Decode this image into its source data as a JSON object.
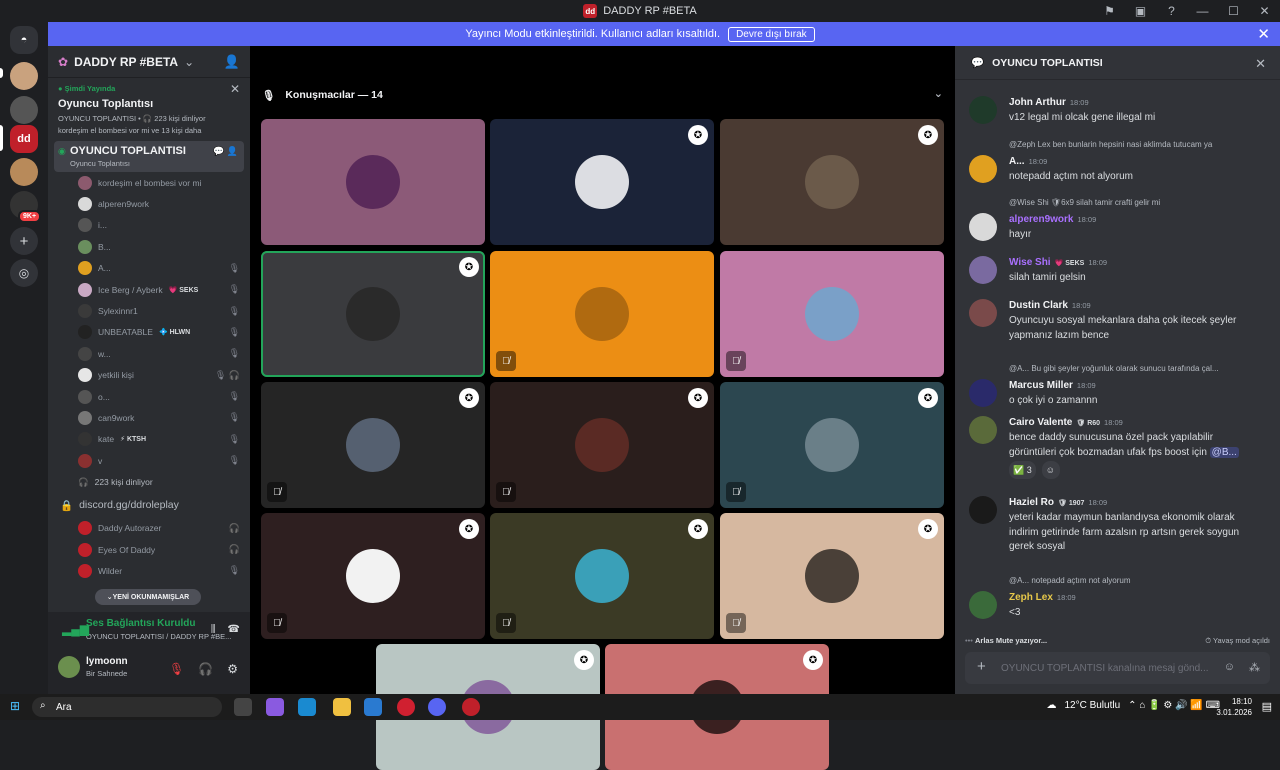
{
  "window": {
    "title": "DADDY RP #BETA",
    "logo": "dd"
  },
  "banner": {
    "text": "Yayıncı Modu etkinleştirildi. Kullanıcı adları kısaltıldı.",
    "button": "Devre dışı bırak"
  },
  "rail": {
    "badge_9k": "9K+"
  },
  "server": {
    "name": "DADDY RP #BETA"
  },
  "live": {
    "status": "Şimdi Yayında",
    "title": "Oyuncu Toplantısı",
    "meta": "OYUNCU TOPLANTISI • 🎧 223 kişi dinliyor",
    "activity": "kordeşim el bombesi vor mi ve 13 kişi daha"
  },
  "active_channel": {
    "name": "OYUNCU TOPLANTISI",
    "subtitle": "Oyuncu Toplantısı"
  },
  "members": [
    {
      "name": "kordeşim el bombesi vor mi",
      "color": "#8c5a6e",
      "badge": "",
      "icon": ""
    },
    {
      "name": "alperen9work",
      "color": "#d9d9d9",
      "badge": "",
      "icon": ""
    },
    {
      "name": "i...",
      "color": "#555",
      "badge": "",
      "icon": ""
    },
    {
      "name": "B...",
      "color": "#6a8f5e",
      "badge": "",
      "icon": ""
    },
    {
      "name": "A...",
      "color": "#e0a020",
      "badge": "",
      "icon": "🎙"
    },
    {
      "name": "Ice Berg / Ayberk",
      "color": "#c9a9c4",
      "badge": "💗 SEKS",
      "icon": "🎙"
    },
    {
      "name": "Sylexinnr1",
      "color": "#3a3a3a",
      "badge": "",
      "icon": "🎙"
    },
    {
      "name": "UNBEATABLE",
      "color": "#222",
      "badge": "💠 HLWN",
      "icon": "🎙"
    },
    {
      "name": "w...",
      "color": "#444",
      "badge": "",
      "icon": "🎙"
    },
    {
      "name": "yetkili kişi",
      "color": "#e6e6e6",
      "badge": "",
      "icon": "🎙 🎧"
    },
    {
      "name": "o...",
      "color": "#555",
      "badge": "",
      "icon": "🎙"
    },
    {
      "name": "can9work",
      "color": "#777",
      "badge": "",
      "icon": "🎙"
    },
    {
      "name": "kate",
      "color": "#333",
      "badge": "⚡ KTSH",
      "icon": "🎙"
    },
    {
      "name": "v",
      "color": "#8a3030",
      "badge": "",
      "icon": "🎙"
    }
  ],
  "listeners": "223 kişi dinliyor",
  "invite": "discord.gg/ddroleplay",
  "bots": [
    {
      "name": "Daddy Autorazer",
      "icon": "🎧"
    },
    {
      "name": "Eyes Of Daddy",
      "icon": "🎧"
    },
    {
      "name": "Wilder",
      "icon": "🎙"
    }
  ],
  "unread_button": "YENİ OKUNMAMIŞLAR",
  "voice": {
    "status": "Ses Bağlantısı Kuruldu",
    "channel": "OYUNCU TOPLANTISI / DADDY RP #BE..."
  },
  "user": {
    "name": "lymoonn",
    "status": "Bir Sahnede"
  },
  "stage": {
    "title": "Konuşmacılar — 14"
  },
  "tiles": [
    {
      "bg": "#8c5a78",
      "av": "#5a2a5a",
      "host": false,
      "mute": false,
      "selected": false
    },
    {
      "bg": "#1b2338",
      "av": "#dcdde2",
      "host": true,
      "mute": false,
      "selected": false
    },
    {
      "bg": "#4a3a32",
      "av": "#6b5a4a",
      "host": true,
      "mute": false,
      "selected": false
    },
    {
      "bg": "#3a3b3e",
      "av": "#2a2a2a",
      "host": true,
      "mute": false,
      "selected": true
    },
    {
      "bg": "#ec8e14",
      "av": "#b06a10",
      "host": false,
      "mute": true,
      "selected": false
    },
    {
      "bg": "#c07aa6",
      "av": "#7aa0c8",
      "host": false,
      "mute": true,
      "selected": false
    },
    {
      "bg": "#252525",
      "av": "#556070",
      "host": true,
      "mute": true,
      "selected": false
    },
    {
      "bg": "#2a1e1c",
      "av": "#5a2a24",
      "host": true,
      "mute": true,
      "selected": false
    },
    {
      "bg": "#2c4750",
      "av": "#6a7f88",
      "host": true,
      "mute": true,
      "selected": false
    },
    {
      "bg": "#2e1f20",
      "av": "#f2f2f2",
      "host": true,
      "mute": true,
      "selected": false
    },
    {
      "bg": "#3b3a25",
      "av": "#3aa0b8",
      "host": true,
      "mute": true,
      "selected": false
    },
    {
      "bg": "#d6b8a0",
      "av": "#4a4038",
      "host": true,
      "mute": true,
      "selected": false
    },
    {
      "bg": "#b9c6c3",
      "av": "#8a6aa0",
      "host": true,
      "mute": false,
      "selected": false
    },
    {
      "bg": "#c97070",
      "av": "#3a2020",
      "host": true,
      "mute": false,
      "selected": false
    }
  ],
  "chat": {
    "title": "OYUNCU TOPLANTISI",
    "messages": [
      {
        "author": "John Arthur",
        "time": "18:09",
        "text": "v12 legal mi olcak gene illegal mi",
        "reply": "",
        "badge": "",
        "color": "#1f3a2a",
        "name_color": "#f2f3f5"
      },
      {
        "author": "A...",
        "time": "18:09",
        "text": "notepadd açtım not alyorum",
        "reply": "@Zeph Lex ben bunlarin hepsini nasi aklimda tutucam ya",
        "badge": "",
        "color": "#e0a020",
        "name_color": "#f2f3f5"
      },
      {
        "author": "alperen9work",
        "time": "18:09",
        "text": "hayır",
        "reply": "@Wise Shi 🛡6x9 silah tamir crafti gelir mi",
        "badge": "",
        "color": "#d9d9d9",
        "name_color": "#a970ff"
      },
      {
        "author": "Wise Shi",
        "time": "18:09",
        "text": "silah tamiri gelsin",
        "reply": "",
        "badge": "💗 SEKS",
        "color": "#7a6aa0",
        "name_color": "#a970ff"
      },
      {
        "author": "Dustin Clark",
        "time": "18:09",
        "text": "Oyuncuyu sosyal mekanlara daha çok itecek şeyler yapmanız lazım bence",
        "reply": "",
        "badge": "",
        "color": "#7a4a4a",
        "name_color": "#f2f3f5"
      },
      {
        "author": "Marcus Miller",
        "time": "18:09",
        "text": "o çok iyi o zamannn",
        "reply": "@A... Bu gibi şeyler yoğunluk olarak sunucu tarafında çal...",
        "badge": "",
        "color": "#2a2a6a",
        "name_color": "#f2f3f5"
      },
      {
        "author": "Cairo Valente",
        "time": "18:09",
        "text": "bence daddy sunucusuna özel pack yapılabilir görüntüleri çok bozmadan ufak fps boost için",
        "mention": "@B...",
        "reply": "",
        "badge": "🛡 R60",
        "color": "#5a6a3a",
        "name_color": "#f2f3f5",
        "reaction": "✅ 3"
      },
      {
        "author": "Haziel Ro",
        "time": "18:09",
        "text": "yeteri kadar maymun banlandıysa ekonomik olarak indirim getirinde farm azalsın rp artsın gerek soygun gerek sosyal",
        "reply": "",
        "badge": "🛡 1907",
        "color": "#1a1a1a",
        "name_color": "#f2f3f5"
      },
      {
        "author": "Zeph Lex",
        "time": "18:09",
        "text": "<3",
        "reply": "@A... notepadd açtım not alyorum",
        "badge": "",
        "color": "#3a6a3a",
        "name_color": "#e6c84a"
      }
    ],
    "typing": "Arlas Mute yazıyor...",
    "slowmode": "Yavaş mod açıldı",
    "input_placeholder": "OYUNCU TOPLANTISI kanalına mesaj gönd..."
  },
  "taskbar": {
    "search": "Ara",
    "weather": "12°C  Bulutlu",
    "time": "18:10",
    "date": "3.01.2026"
  }
}
